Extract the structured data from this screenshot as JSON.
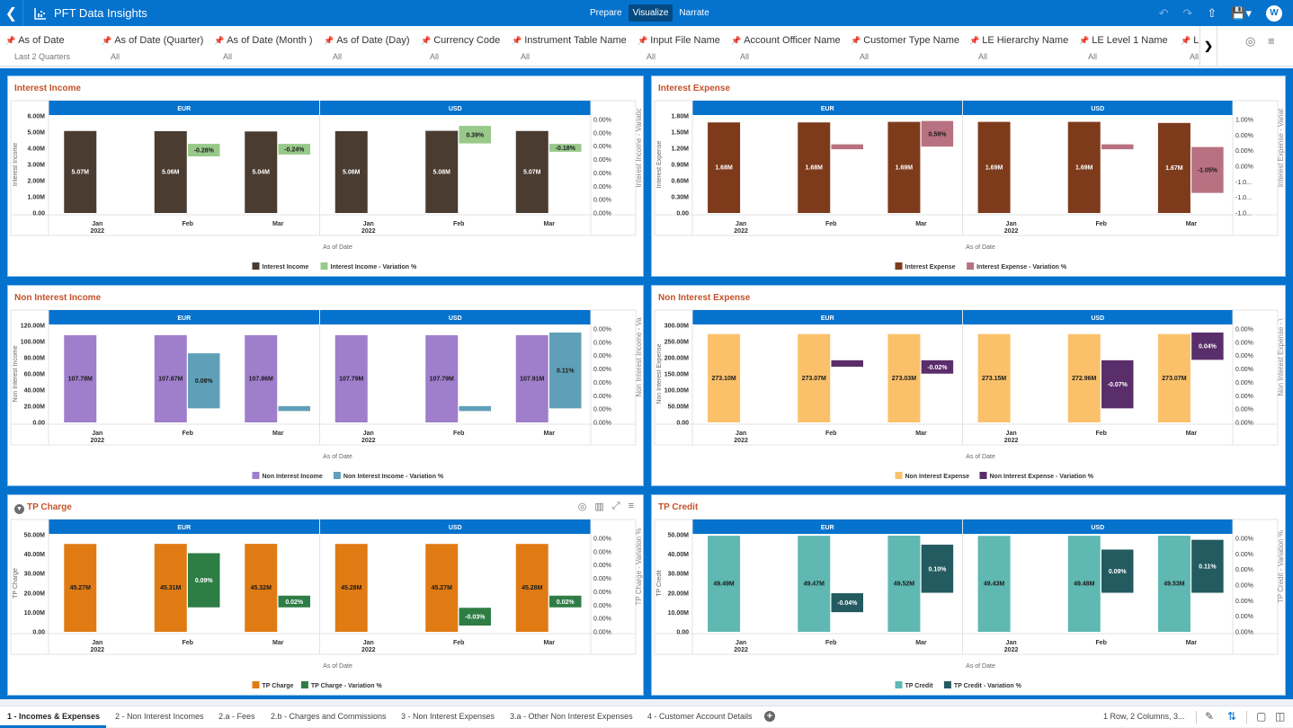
{
  "header": {
    "title": "PFT Data Insights",
    "modes": [
      {
        "label": "Prepare",
        "active": false
      },
      {
        "label": "Visualize",
        "active": true
      },
      {
        "label": "Narrate",
        "active": false
      }
    ],
    "icons": [
      "undo-icon",
      "redo-icon",
      "export-icon",
      "save-icon",
      "user-avatar"
    ],
    "avatar_initial": "W"
  },
  "filters": [
    {
      "name": "As of Date",
      "value": "Last 2 Quarters"
    },
    {
      "name": "As of Date (Quarter)",
      "value": "All"
    },
    {
      "name": "As of Date (Month )",
      "value": "All"
    },
    {
      "name": "As of Date (Day)",
      "value": "All"
    },
    {
      "name": "Currency Code",
      "value": "All"
    },
    {
      "name": "Instrument Table Name",
      "value": "All"
    },
    {
      "name": "Input File Name",
      "value": "All"
    },
    {
      "name": "Account Officer Name",
      "value": "All"
    },
    {
      "name": "Customer Type Name",
      "value": "All"
    },
    {
      "name": "LE Hierarchy Name",
      "value": "All"
    },
    {
      "name": "LE Level 1 Name",
      "value": "All"
    },
    {
      "name": "LE",
      "value": "All"
    }
  ],
  "chart_data": [
    {
      "type": "bar",
      "title": "Interest Income",
      "xlabel": "As of Date",
      "ylabel": "Interest Income",
      "y2label": "Interest Income - Variatic",
      "facets": [
        "EUR",
        "USD"
      ],
      "categories": [
        "Jan\n2022",
        "Feb",
        "Mar"
      ],
      "yticks": [
        "0.00",
        "1.00M",
        "2.00M",
        "3.00M",
        "4.00M",
        "5.00M",
        "6.00M"
      ],
      "ylim": [
        0,
        6
      ],
      "y2ticks": [
        "0.00%",
        "0.00%",
        "0.00%",
        "0.00%",
        "0.00%",
        "0.00%",
        "0.00%",
        "0.00%"
      ],
      "y2lim": [
        -1.5,
        0.6
      ],
      "series": [
        {
          "name": "Interest Income",
          "color": "#4a3c31",
          "labelColor": "#ffffff",
          "values": {
            "EUR": [
              5.07,
              5.06,
              5.04
            ],
            "USD": [
              5.06,
              5.08,
              5.07
            ]
          },
          "labels": {
            "EUR": [
              "5.07M",
              "5.06M",
              "5.04M"
            ],
            "USD": [
              "5.06M",
              "5.08M",
              "5.07M"
            ]
          }
        },
        {
          "name": "Interest Income - Variation %",
          "color": "#98c98a",
          "labelColor": "#1a1a1a",
          "variation": true,
          "values": {
            "EUR": [
              null,
              -0.28,
              -0.24
            ],
            "USD": [
              null,
              0.39,
              -0.18
            ]
          },
          "labels": {
            "EUR": [
              "",
              "-0.28%",
              "-0.24%"
            ],
            "USD": [
              "",
              "0.39%",
              "-0.18%"
            ]
          }
        }
      ],
      "legend": "bottom"
    },
    {
      "type": "bar",
      "title": "Interest Expense",
      "xlabel": "As of Date",
      "ylabel": "Interest Expense",
      "y2label": "Interest Expense - Variat",
      "facets": [
        "EUR",
        "USD"
      ],
      "categories": [
        "Jan\n2022",
        "Feb",
        "Mar"
      ],
      "yticks": [
        "0.00",
        "0.30M",
        "0.60M",
        "0.90M",
        "1.20M",
        "1.50M",
        "1.80M"
      ],
      "ylim": [
        0,
        1.8
      ],
      "y2ticks": [
        "1.00%",
        "0.00%",
        "0.00%",
        "0.00%",
        "-1.0...",
        "-1.0...",
        "-1.0..."
      ],
      "y2lim": [
        -1.5,
        0.7
      ],
      "series": [
        {
          "name": "Interest Expense",
          "color": "#7e3b1c",
          "labelColor": "#ffffff",
          "values": {
            "EUR": [
              1.68,
              1.68,
              1.69
            ],
            "USD": [
              1.69,
              1.69,
              1.67
            ]
          },
          "labels": {
            "EUR": [
              "1.68M",
              "1.68M",
              "1.69M"
            ],
            "USD": [
              "1.69M",
              "1.69M",
              "1.67M"
            ]
          }
        },
        {
          "name": "Interest Expense - Variation %",
          "color": "#b87180",
          "labelColor": "#1a1a1a",
          "variation": true,
          "values": {
            "EUR": [
              null,
              0.005,
              0.59
            ],
            "USD": [
              null,
              0.005,
              -1.05
            ]
          },
          "labels": {
            "EUR": [
              "",
              "",
              "0.59%"
            ],
            "USD": [
              "",
              "",
              "-1.05%"
            ]
          }
        }
      ],
      "legend": "bottom"
    },
    {
      "type": "bar",
      "title": "Non Interest Income",
      "xlabel": "As of Date",
      "ylabel": "Non Interest Income",
      "y2label": "Non Interest Income - Va",
      "facets": [
        "EUR",
        "USD"
      ],
      "categories": [
        "Jan\n2022",
        "Feb",
        "Mar"
      ],
      "yticks": [
        "0.00",
        "20.00M",
        "40.00M",
        "60.00M",
        "80.00M",
        "100.00M",
        "120.00M"
      ],
      "ylim": [
        0,
        120
      ],
      "y2ticks": [
        "0.00%",
        "0.00%",
        "0.00%",
        "0.00%",
        "0.00%",
        "0.00%",
        "0.00%",
        "0.00%"
      ],
      "y2lim": [
        -0.02,
        0.12
      ],
      "series": [
        {
          "name": "Non Interest Income",
          "color": "#9f7ecb",
          "labelColor": "#1a1a1a",
          "values": {
            "EUR": [
              107.78,
              107.87,
              107.86
            ],
            "USD": [
              107.79,
              107.79,
              107.91
            ]
          },
          "labels": {
            "EUR": [
              "107.78M",
              "107.87M",
              "107.86M"
            ],
            "USD": [
              "107.79M",
              "107.79M",
              "107.91M"
            ]
          }
        },
        {
          "name": "Non Interest Income - Variation %",
          "color": "#5fa0b8",
          "labelColor": "#1a1a1a",
          "variation": true,
          "values": {
            "EUR": [
              null,
              0.08,
              -0.005
            ],
            "USD": [
              null,
              0.0005,
              0.11
            ]
          },
          "labels": {
            "EUR": [
              "",
              "0.08%",
              ""
            ],
            "USD": [
              "",
              "",
              "0.11%"
            ]
          }
        }
      ],
      "legend": "bottom"
    },
    {
      "type": "bar",
      "title": "Non Interest Expense",
      "xlabel": "As of Date",
      "ylabel": "Non Interest Expense",
      "y2label": "Non Interest Expense - \\",
      "facets": [
        "EUR",
        "USD"
      ],
      "categories": [
        "Jan\n2022",
        "Feb",
        "Mar"
      ],
      "yticks": [
        "0.00",
        "50.00M",
        "100.00M",
        "150.00M",
        "200.00M",
        "250.00M",
        "300.00M"
      ],
      "ylim": [
        0,
        300
      ],
      "y2ticks": [
        "0.00%",
        "0.00%",
        "0.00%",
        "0.00%",
        "0.00%",
        "0.00%",
        "0.00%",
        "0.00%"
      ],
      "y2lim": [
        -0.09,
        0.05
      ],
      "series": [
        {
          "name": "Non Interest Expense",
          "color": "#fbc16a",
          "labelColor": "#1a1a1a",
          "values": {
            "EUR": [
              273.1,
              273.07,
              273.03
            ],
            "USD": [
              273.15,
              272.96,
              273.07
            ]
          },
          "labels": {
            "EUR": [
              "273.10M",
              "273.07M",
              "273.03M"
            ],
            "USD": [
              "273.15M",
              "272.96M",
              "273.07M"
            ]
          }
        },
        {
          "name": "Non Interest Expense - Variation %",
          "color": "#5a2e6a",
          "labelColor": "#ffffff",
          "variation": true,
          "values": {
            "EUR": [
              null,
              -0.01,
              -0.02
            ],
            "USD": [
              null,
              -0.07,
              0.04
            ]
          },
          "labels": {
            "EUR": [
              "",
              "",
              "-0.02%"
            ],
            "USD": [
              "",
              "-0.07%",
              "0.04%"
            ]
          }
        }
      ],
      "legend": "bottom"
    },
    {
      "type": "bar",
      "title": "TP Charge",
      "xlabel": "As of Date",
      "ylabel": "TP Charge",
      "y2label": "TP Charge - Variation %",
      "facets": [
        "EUR",
        "USD"
      ],
      "categories": [
        "Jan\n2022",
        "Feb",
        "Mar"
      ],
      "yticks": [
        "0.00",
        "10.00M",
        "20.00M",
        "30.00M",
        "40.00M",
        "50.00M"
      ],
      "ylim": [
        0,
        50
      ],
      "y2ticks": [
        "0.00%",
        "0.00%",
        "0.00%",
        "0.00%",
        "0.00%",
        "0.00%",
        "0.00%",
        "0.00%"
      ],
      "y2lim": [
        -0.04,
        0.12
      ],
      "series": [
        {
          "name": "TP Charge",
          "color": "#e07b14",
          "labelColor": "#1a1a1a",
          "values": {
            "EUR": [
              45.27,
              45.31,
              45.32
            ],
            "USD": [
              45.28,
              45.27,
              45.28
            ]
          },
          "labels": {
            "EUR": [
              "45.27M",
              "45.31M",
              "45.32M"
            ],
            "USD": [
              "45.28M",
              "45.27M",
              "45.28M"
            ]
          }
        },
        {
          "name": "TP Charge - Variation %",
          "color": "#2e7d45",
          "labelColor": "#ffffff",
          "variation": true,
          "values": {
            "EUR": [
              null,
              0.09,
              0.02
            ],
            "USD": [
              null,
              -0.03,
              0.02
            ]
          },
          "labels": {
            "EUR": [
              "",
              "0.09%",
              "0.02%"
            ],
            "USD": [
              "",
              "-0.03%",
              "0.02%"
            ]
          }
        }
      ],
      "legend": "bottom",
      "tools": [
        "target-icon",
        "bar-chart-icon",
        "maximize-icon",
        "menu-icon"
      ],
      "filtered": true
    },
    {
      "type": "bar",
      "title": "TP Credit",
      "xlabel": "As of Date",
      "ylabel": "TP Credit",
      "y2label": "TP Credit - Variation %",
      "facets": [
        "EUR",
        "USD"
      ],
      "categories": [
        "Jan\n2022",
        "Feb",
        "Mar"
      ],
      "yticks": [
        "0.00",
        "10.00M",
        "20.00M",
        "30.00M",
        "40.00M",
        "50.00M"
      ],
      "ylim": [
        0,
        50
      ],
      "y2ticks": [
        "0.00%",
        "0.00%",
        "0.00%",
        "0.00%",
        "0.00%",
        "0.00%",
        "0.00%"
      ],
      "y2lim": [
        -0.08,
        0.12
      ],
      "series": [
        {
          "name": "TP Credit",
          "color": "#5fb8b2",
          "labelColor": "#1a1a1a",
          "values": {
            "EUR": [
              49.49,
              49.47,
              49.52
            ],
            "USD": [
              49.43,
              49.48,
              49.53
            ]
          },
          "labels": {
            "EUR": [
              "49.49M",
              "49.47M",
              "49.52M"
            ],
            "USD": [
              "49.43M",
              "49.48M",
              "49.53M"
            ]
          }
        },
        {
          "name": "TP Credit - Variation %",
          "color": "#235b61",
          "labelColor": "#ffffff",
          "variation": true,
          "values": {
            "EUR": [
              null,
              -0.04,
              0.1
            ],
            "USD": [
              null,
              0.09,
              0.11
            ]
          },
          "labels": {
            "EUR": [
              "",
              "-0.04%",
              "0.10%"
            ],
            "USD": [
              "",
              "0.09%",
              "0.11%"
            ]
          }
        }
      ],
      "legend": "bottom"
    }
  ],
  "tabs": [
    {
      "label": "1 - Incomes & Expenses",
      "active": true
    },
    {
      "label": "2 - Non Interest Incomes",
      "active": false
    },
    {
      "label": "2.a - Fees",
      "active": false
    },
    {
      "label": "2.b - Charges and Commissions",
      "active": false
    },
    {
      "label": "3 - Non Interest Expenses",
      "active": false
    },
    {
      "label": "3.a - Other Non Interest Expenses",
      "active": false
    },
    {
      "label": "4 - Customer Account Details",
      "active": false
    }
  ],
  "status": {
    "layout_text": "1 Row, 2 Columns, 3..."
  }
}
